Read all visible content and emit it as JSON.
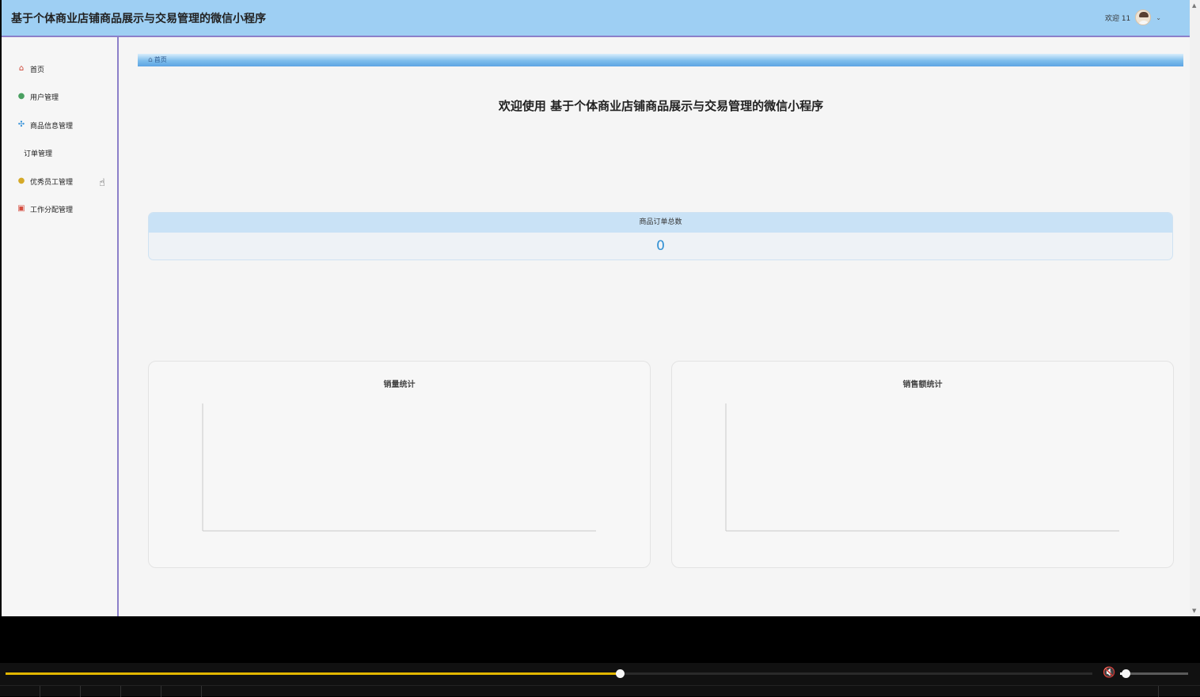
{
  "header": {
    "title": "基于个体商业店铺商品展示与交易管理的微信小程序",
    "welcome": "欢迎 11",
    "chevron": "⌄"
  },
  "sidebar": {
    "items": [
      {
        "label": "首页",
        "icon": "home-icon",
        "color": "#cc3f2f",
        "glyph": "⌂"
      },
      {
        "label": "用户管理",
        "icon": "user-icon",
        "color": "#4aa061",
        "glyph": "●"
      },
      {
        "label": "商品信息管理",
        "icon": "grid-icon",
        "color": "#2c8dd8",
        "glyph": "✣"
      },
      {
        "label": "订单管理",
        "icon": "",
        "color": "",
        "glyph": ""
      },
      {
        "label": "优秀员工管理",
        "icon": "medal-icon",
        "color": "#d5a928",
        "glyph": "●"
      },
      {
        "label": "工作分配管理",
        "icon": "briefcase-icon",
        "color": "#d54c3f",
        "glyph": "▣"
      }
    ]
  },
  "breadcrumb": {
    "home_icon": "⌂",
    "label": "首页"
  },
  "main": {
    "title": "欢迎使用 基于个体商业店铺商品展示与交易管理的微信小程序",
    "stat": {
      "label": "商品订单总数",
      "value": "0"
    },
    "charts": [
      {
        "title": "销量统计"
      },
      {
        "title": "销售额统计"
      }
    ]
  },
  "scrollbar": {
    "up_arrow": "▲",
    "down_arrow": "▼"
  },
  "cursor": {
    "icon": "☝"
  },
  "media_controls": {
    "progress_fraction": 0.565,
    "volume_fraction": 0.08,
    "volume_icon": "🔇",
    "accent_color": "#e1b600"
  },
  "chart_data": [
    {
      "type": "bar",
      "title": "销量统计",
      "categories": [],
      "values": []
    },
    {
      "type": "bar",
      "title": "销售额统计",
      "categories": [],
      "values": []
    }
  ]
}
